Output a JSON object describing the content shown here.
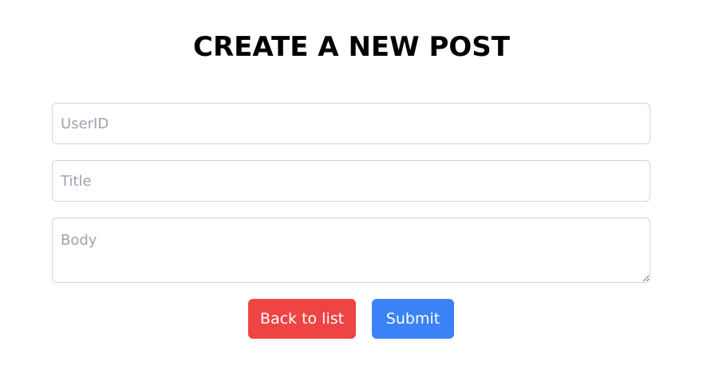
{
  "page": {
    "title": "CREATE A NEW POST"
  },
  "form": {
    "userid": {
      "placeholder": "UserID",
      "value": ""
    },
    "title": {
      "placeholder": "Title",
      "value": ""
    },
    "body": {
      "placeholder": "Body",
      "value": ""
    }
  },
  "actions": {
    "back_label": "Back to list",
    "submit_label": "Submit"
  },
  "colors": {
    "back_button": "#ef4444",
    "submit_button": "#3b82f6",
    "input_border": "#d1d5db",
    "placeholder": "#9ca3af"
  }
}
